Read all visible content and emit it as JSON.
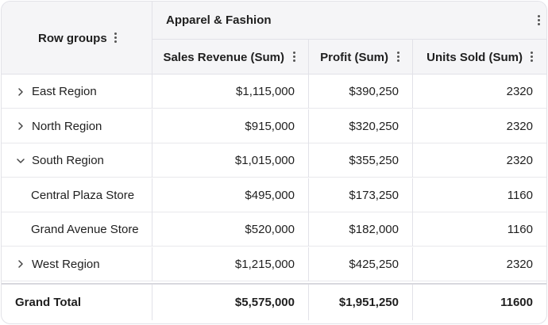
{
  "header": {
    "row_groups_label": "Row groups",
    "group_label": "Apparel & Fashion",
    "columns": [
      "Sales Revenue (Sum)",
      "Profit (Sum)",
      "Units Sold (Sum)"
    ]
  },
  "rows": [
    {
      "label": "East Region",
      "expander": "chevron-right",
      "revenue": "$1,115,000",
      "profit": "$390,250",
      "units": "2320"
    },
    {
      "label": "North Region",
      "expander": "chevron-right",
      "revenue": "$915,000",
      "profit": "$320,250",
      "units": "2320"
    },
    {
      "label": "South Region",
      "expander": "chevron-down",
      "revenue": "$1,015,000",
      "profit": "$355,250",
      "units": "2320"
    },
    {
      "label": "Central Plaza Store",
      "expander": "none",
      "revenue": "$495,000",
      "profit": "$173,250",
      "units": "1160"
    },
    {
      "label": "Grand Avenue Store",
      "expander": "none",
      "revenue": "$520,000",
      "profit": "$182,000",
      "units": "1160"
    },
    {
      "label": "West Region",
      "expander": "chevron-right",
      "revenue": "$1,215,000",
      "profit": "$425,250",
      "units": "2320"
    }
  ],
  "total": {
    "label": "Grand Total",
    "revenue": "$5,575,000",
    "profit": "$1,951,250",
    "units": "11600"
  },
  "colors": {
    "header_bg": "#f5f5f7",
    "border": "#e2e2e8",
    "text": "#1f1f1f"
  }
}
